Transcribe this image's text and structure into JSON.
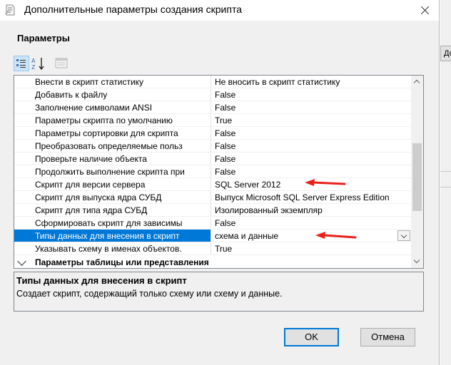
{
  "window": {
    "title": "Дополнительные параметры создания скрипта"
  },
  "background_window": {
    "button_fragment": "До"
  },
  "section_title": "Параметры",
  "toolbar": {
    "categorized_icon": "categorized-view-icon",
    "alphabetical_icon": "sort-az-icon",
    "property_pages_icon": "property-pages-icon"
  },
  "properties": [
    {
      "name": "Внести в скрипт статистику",
      "value": "Не вносить в скрипт статистику"
    },
    {
      "name": "Добавить к файлу",
      "value": "False"
    },
    {
      "name": "Заполнение символами ANSI",
      "value": "False"
    },
    {
      "name": "Параметры скрипта по умолчанию",
      "value": "True"
    },
    {
      "name": "Параметры сортировки для скрипта",
      "value": "False"
    },
    {
      "name": "Преобразовать определяемые польз",
      "value": "False"
    },
    {
      "name": "Проверьте наличие объекта",
      "value": "False"
    },
    {
      "name": "Продолжить выполнение скрипта при",
      "value": "False"
    },
    {
      "name": "Скрипт для версии сервера",
      "value": "SQL Server 2012"
    },
    {
      "name": "Скрипт для выпуска ядра СУБД",
      "value": "Выпуск Microsoft SQL Server Express Edition"
    },
    {
      "name": "Скрипт для типа ядра СУБД",
      "value": "Изолированный экземпляр"
    },
    {
      "name": "Сформировать скрипт для зависимы",
      "value": "False"
    },
    {
      "name": "Типы данных для внесения в скрипт",
      "value": "схема и данные",
      "selected": true
    },
    {
      "name": "Указывать схему в именах объектов.",
      "value": "True"
    }
  ],
  "category": {
    "label": "Параметры таблицы или представления"
  },
  "description": {
    "title": "Типы данных для внесения в скрипт",
    "text": "Создает скрипт, содержащий только схему или схему и данные."
  },
  "buttons": {
    "ok": "OK",
    "cancel": "Отмена"
  },
  "colors": {
    "selection": "#0078d7",
    "annotation_arrow": "#e8211c",
    "dialog_bg": "#f0f0f0"
  }
}
